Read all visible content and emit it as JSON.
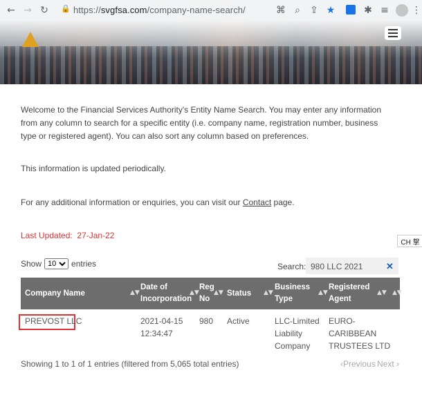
{
  "browser": {
    "back_icon": "arrow-left-icon",
    "forward_icon": "arrow-right-icon",
    "reload_icon": "reload-icon",
    "url_scheme": "https://",
    "url_host": "svgfsa.com",
    "url_path": "/company-name-search/"
  },
  "page": {
    "intro": "Welcome to the Financial Services Authority's Entity Name Search. You may enter any information from any column to search for a specific entity (i.e. company name, registration number, business type or registered agent). You can also sort any column based on preferences.",
    "periodic": "This information is updated periodically.",
    "contact_prefix": "For any additional information or enquiries, you can visit our ",
    "contact_link": "Contact",
    "contact_suffix": " page.",
    "last_updated_label": "Last Updated:",
    "last_updated_value": "27-Jan-22",
    "ime_label": "CH 㧳"
  },
  "table_controls": {
    "show_label": "Show",
    "entries_label": "entries",
    "page_size": "10",
    "search_label": "Search:",
    "search_value": "980 LLC 2021"
  },
  "table": {
    "headers": [
      {
        "line1": "Company Name",
        "line2": ""
      },
      {
        "line1": "Date of",
        "line2": "Incorporation"
      },
      {
        "line1": "Reg",
        "line2": "No"
      },
      {
        "line1": "Status",
        "line2": ""
      },
      {
        "line1": "Business",
        "line2": "Type"
      },
      {
        "line1": "Registered",
        "line2": "Agent"
      }
    ],
    "rows": [
      {
        "company": "PREVOST LLC",
        "date1": "2021-04-15",
        "date2": "12:34:47",
        "reg_no": "980",
        "status": "Active",
        "type1": "LLC-Limited",
        "type2": "Liability",
        "type3": "Company",
        "agent1": "EURO-",
        "agent2": "CARIBBEAN",
        "agent3": "TRUSTEES LTD"
      }
    ]
  },
  "footer": {
    "info": "Showing 1 to 1 of 1 entries (filtered from 5,065 total entries)",
    "previous": "Previous",
    "next": "Next"
  },
  "colors": {
    "header_bg": "#6d6d6d",
    "updated_red": "#e03030",
    "highlight_box": "#e03030"
  }
}
